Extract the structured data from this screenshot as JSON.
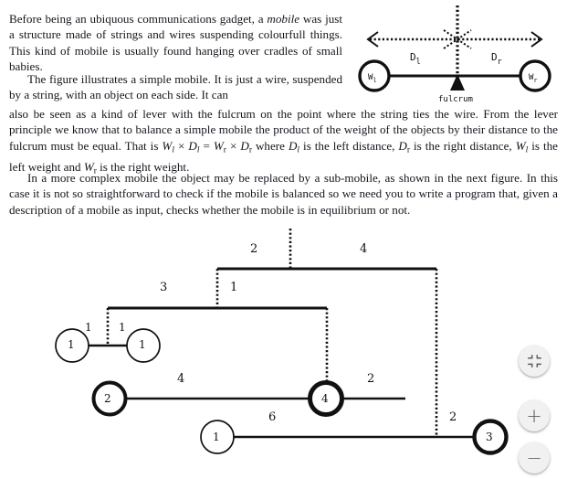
{
  "document": {
    "paragraphs": [
      {
        "id": "p1",
        "text": "Before being an ubiquous communications gadget, a mobile was just a structure made of strings and wires suspending colourfull things. This kind of mobile is usually found hanging over cradles of small babies.",
        "italic_terms": [
          "mobile"
        ]
      },
      {
        "id": "p2",
        "text": "The figure illustrates a simple mobile. It is just a wire, suspended by a string, with an object on each side. It can also be seen as a kind of lever with the fulcrum on the point where the string ties the wire. From the lever principle we know that to balance a simple mobile the product of the weight of the objects by their distance to the fulcrum must be equal. That is Wl × Dl = Wr × Dr where Dl is the left distance, Dr is the right distance, Wl is the left weight and Wr is the right weight."
      },
      {
        "id": "p3",
        "text": "In a more complex mobile the object may be replaced by a sub-mobile, as shown in the next figure. In this case it is not so straightforward to check if the mobile is balanced so we need you to write a program that, given a description of a mobile as input, checks whether the mobile is in equilibrium or not."
      }
    ]
  },
  "figure_simple": {
    "name": "simple-mobile-diagram",
    "labels": {
      "left_weight": "W",
      "left_weight_sub": "l",
      "right_weight": "W",
      "right_weight_sub": "r",
      "left_distance": "D",
      "left_distance_sub": "l",
      "right_distance": "D",
      "right_distance_sub": "r",
      "fulcrum": "fulcrum"
    }
  },
  "figure_complex": {
    "name": "complex-mobile-diagram",
    "beams": [
      {
        "id": "beam-top",
        "left_distance": "2",
        "right_distance": "4"
      },
      {
        "id": "beam-second",
        "left_distance": "3",
        "right_distance": "1"
      },
      {
        "id": "beam-small",
        "left_distance": "1",
        "right_distance": "1"
      },
      {
        "id": "beam-middle",
        "left_distance": "4",
        "right_distance": "2"
      },
      {
        "id": "beam-bottom",
        "left_distance": "6",
        "right_distance": "2"
      }
    ],
    "weights": [
      {
        "id": "w-small-left",
        "value": "1",
        "style": "thin"
      },
      {
        "id": "w-small-right",
        "value": "1",
        "style": "thin"
      },
      {
        "id": "w-middle-left",
        "value": "2",
        "style": "thick"
      },
      {
        "id": "w-middle-right",
        "value": "4",
        "style": "thick"
      },
      {
        "id": "w-bottom-left",
        "value": "1",
        "style": "thin"
      },
      {
        "id": "w-bottom-right",
        "value": "3",
        "style": "thick"
      }
    ]
  },
  "controls": {
    "fit": {
      "label": "⤡",
      "name": "fit-to-screen-button"
    },
    "zoom_in": {
      "label": "+",
      "name": "zoom-in-button"
    },
    "zoom_out": {
      "label": "−",
      "name": "zoom-out-button"
    }
  },
  "colors": {
    "ink": "#16161e",
    "background": "#ffffff",
    "fab_bg": "#f1f1f1",
    "fab_glyph": "#5d5d5d"
  }
}
